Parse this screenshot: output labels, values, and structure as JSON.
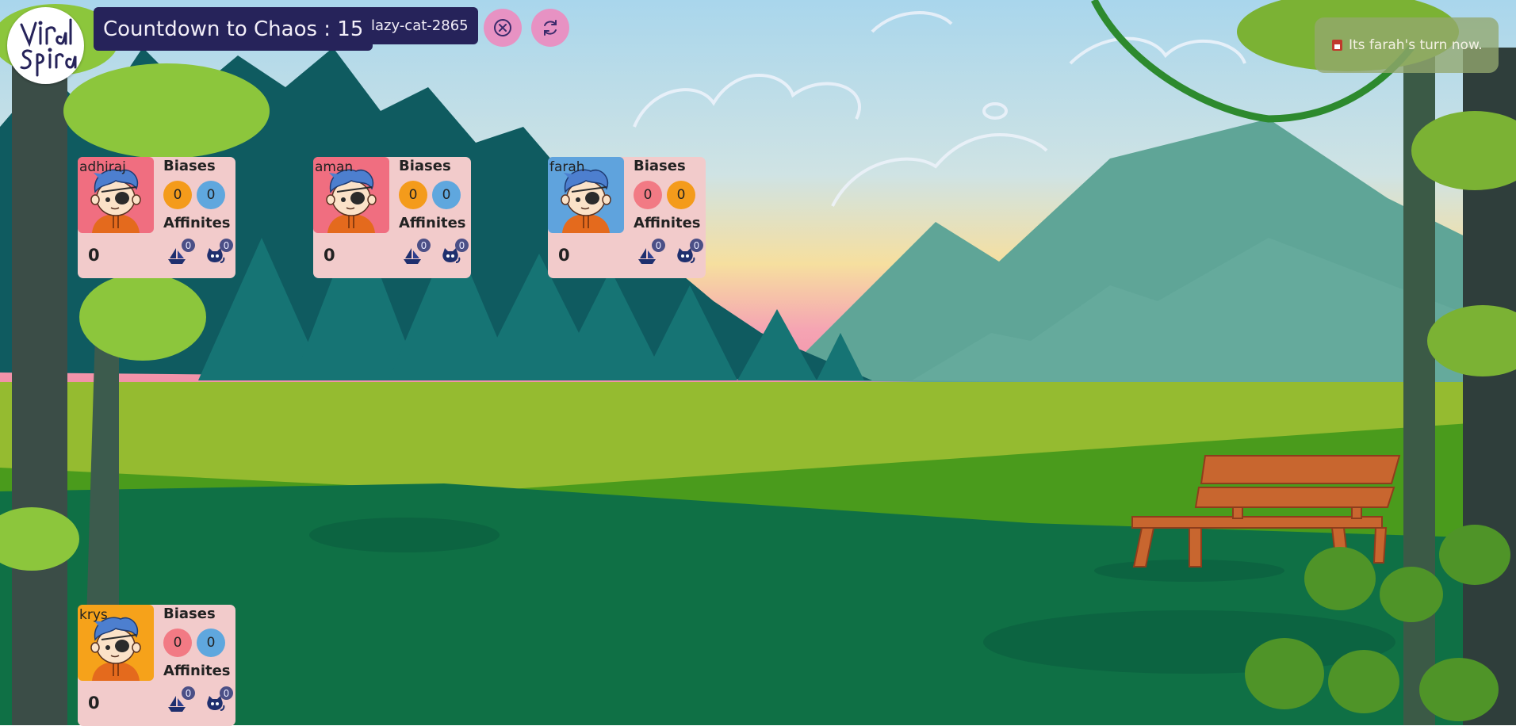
{
  "header": {
    "countdown_label": "Countdown to Chaos : 15",
    "room_name": "lazy-cat-2865",
    "logo_text": "Viral Spiral"
  },
  "buttons": {
    "close": {
      "icon": "circle-x-icon"
    },
    "refresh": {
      "icon": "refresh-icon"
    }
  },
  "notification": {
    "text": "Its farah's turn now.",
    "icon": "bell-icon"
  },
  "labels": {
    "biases": "Biases",
    "affinities": "Affinites"
  },
  "colors": {
    "title_bg": "#26235a",
    "button_bg": "#e792c3",
    "card_bg": "#f2cbcb",
    "bias_orange": "#f49b1b",
    "bias_blue": "#5fa7de",
    "bias_red": "#f27a84",
    "avatar_red": "#f06e80",
    "avatar_blue": "#5fa3dd",
    "avatar_orange": "#f6a21a"
  },
  "players": [
    {
      "name": "adhiraj",
      "avatar_color": "#f06e80",
      "score": "0",
      "biases": [
        {
          "value": "0",
          "color": "#f49b1b"
        },
        {
          "value": "0",
          "color": "#5fa7de"
        }
      ],
      "affinities": [
        {
          "icon": "boat-icon",
          "count": "0"
        },
        {
          "icon": "cat-icon",
          "count": "0"
        }
      ]
    },
    {
      "name": "aman",
      "avatar_color": "#f06e80",
      "score": "0",
      "biases": [
        {
          "value": "0",
          "color": "#f49b1b"
        },
        {
          "value": "0",
          "color": "#5fa7de"
        }
      ],
      "affinities": [
        {
          "icon": "boat-icon",
          "count": "0"
        },
        {
          "icon": "cat-icon",
          "count": "0"
        }
      ]
    },
    {
      "name": "farah",
      "avatar_color": "#5fa3dd",
      "score": "0",
      "biases": [
        {
          "value": "0",
          "color": "#f27a84"
        },
        {
          "value": "0",
          "color": "#f49b1b"
        }
      ],
      "affinities": [
        {
          "icon": "boat-icon",
          "count": "0"
        },
        {
          "icon": "cat-icon",
          "count": "0"
        }
      ]
    },
    {
      "name": "krys",
      "avatar_color": "#f6a21a",
      "score": "0",
      "biases": [
        {
          "value": "0",
          "color": "#f27a84"
        },
        {
          "value": "0",
          "color": "#5fa7de"
        }
      ],
      "affinities": [
        {
          "icon": "boat-icon",
          "count": "0"
        },
        {
          "icon": "cat-icon",
          "count": "0"
        }
      ]
    }
  ]
}
